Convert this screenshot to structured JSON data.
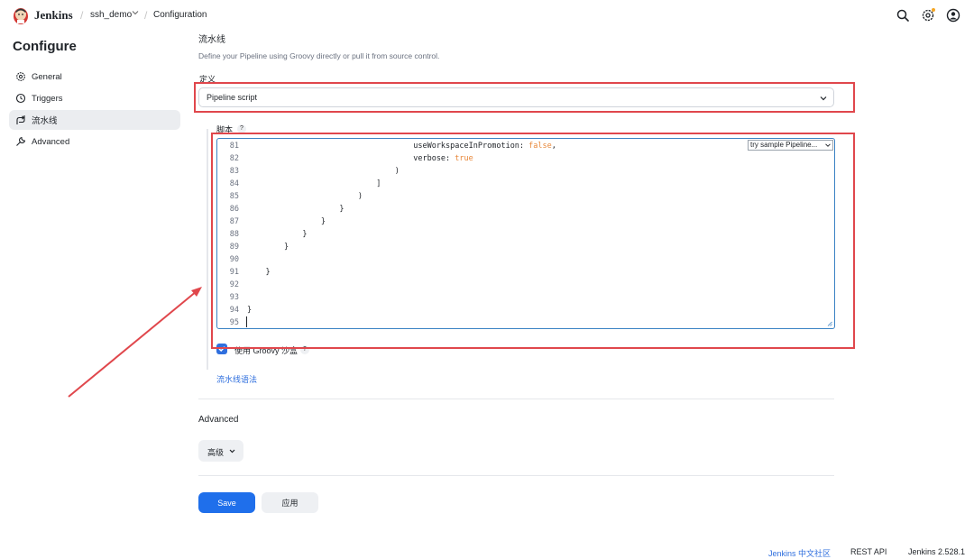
{
  "header": {
    "brand": "Jenkins",
    "breadcrumb_job": "ssh_demo",
    "breadcrumb_page": "Configuration",
    "icons": [
      "search-icon",
      "settings-icon",
      "user-icon"
    ],
    "notification_color": "#f5a623"
  },
  "sidebar": {
    "title": "Configure",
    "items": [
      {
        "label": "General",
        "icon": "gear-icon",
        "active": false
      },
      {
        "label": "Triggers",
        "icon": "clock-icon",
        "active": false
      },
      {
        "label": "流水线",
        "icon": "pipeline-icon",
        "active": true
      },
      {
        "label": "Advanced",
        "icon": "wrench-icon",
        "active": false
      }
    ]
  },
  "pipeline": {
    "title": "流水线",
    "description": "Define your Pipeline using Groovy directly or pull it from source control.",
    "definition_label": "定义",
    "definition_value": "Pipeline script",
    "script_label": "脚本",
    "help": "?",
    "sample_select": "try sample Pipeline...",
    "code_lines": [
      {
        "n": "81",
        "text": "                                    useWorkspaceInPromotion: ",
        "kw": "false",
        "tail": ","
      },
      {
        "n": "82",
        "text": "                                    verbose: ",
        "kw": "true",
        "tail": ""
      },
      {
        "n": "83",
        "text": "                                )",
        "kw": "",
        "tail": ""
      },
      {
        "n": "84",
        "text": "                            ]",
        "kw": "",
        "tail": ""
      },
      {
        "n": "85",
        "text": "                        )",
        "kw": "",
        "tail": ""
      },
      {
        "n": "86",
        "text": "                    }",
        "kw": "",
        "tail": ""
      },
      {
        "n": "87",
        "text": "                }",
        "kw": "",
        "tail": ""
      },
      {
        "n": "88",
        "text": "            }",
        "kw": "",
        "tail": ""
      },
      {
        "n": "89",
        "text": "        }",
        "kw": "",
        "tail": ""
      },
      {
        "n": "90",
        "text": "",
        "kw": "",
        "tail": ""
      },
      {
        "n": "91",
        "text": "    }",
        "kw": "",
        "tail": ""
      },
      {
        "n": "92",
        "text": "",
        "kw": "",
        "tail": ""
      },
      {
        "n": "93",
        "text": "",
        "kw": "",
        "tail": ""
      },
      {
        "n": "94",
        "text": "}",
        "kw": "",
        "tail": ""
      },
      {
        "n": "95",
        "text": "",
        "kw": "",
        "tail": ""
      }
    ],
    "sandbox_label": "使用 Groovy 沙盒",
    "sandbox_checked": true,
    "syntax_link": "流水线语法"
  },
  "advanced": {
    "title": "Advanced",
    "button": "高级"
  },
  "actions": {
    "save": "Save",
    "apply": "应用"
  },
  "footer": {
    "community": "Jenkins 中文社区",
    "rest_api": "REST API",
    "version": "Jenkins 2.528.1"
  },
  "colors": {
    "accent": "#1f6feb",
    "annotation": "#e0474c",
    "keyword": "#e8883a"
  }
}
